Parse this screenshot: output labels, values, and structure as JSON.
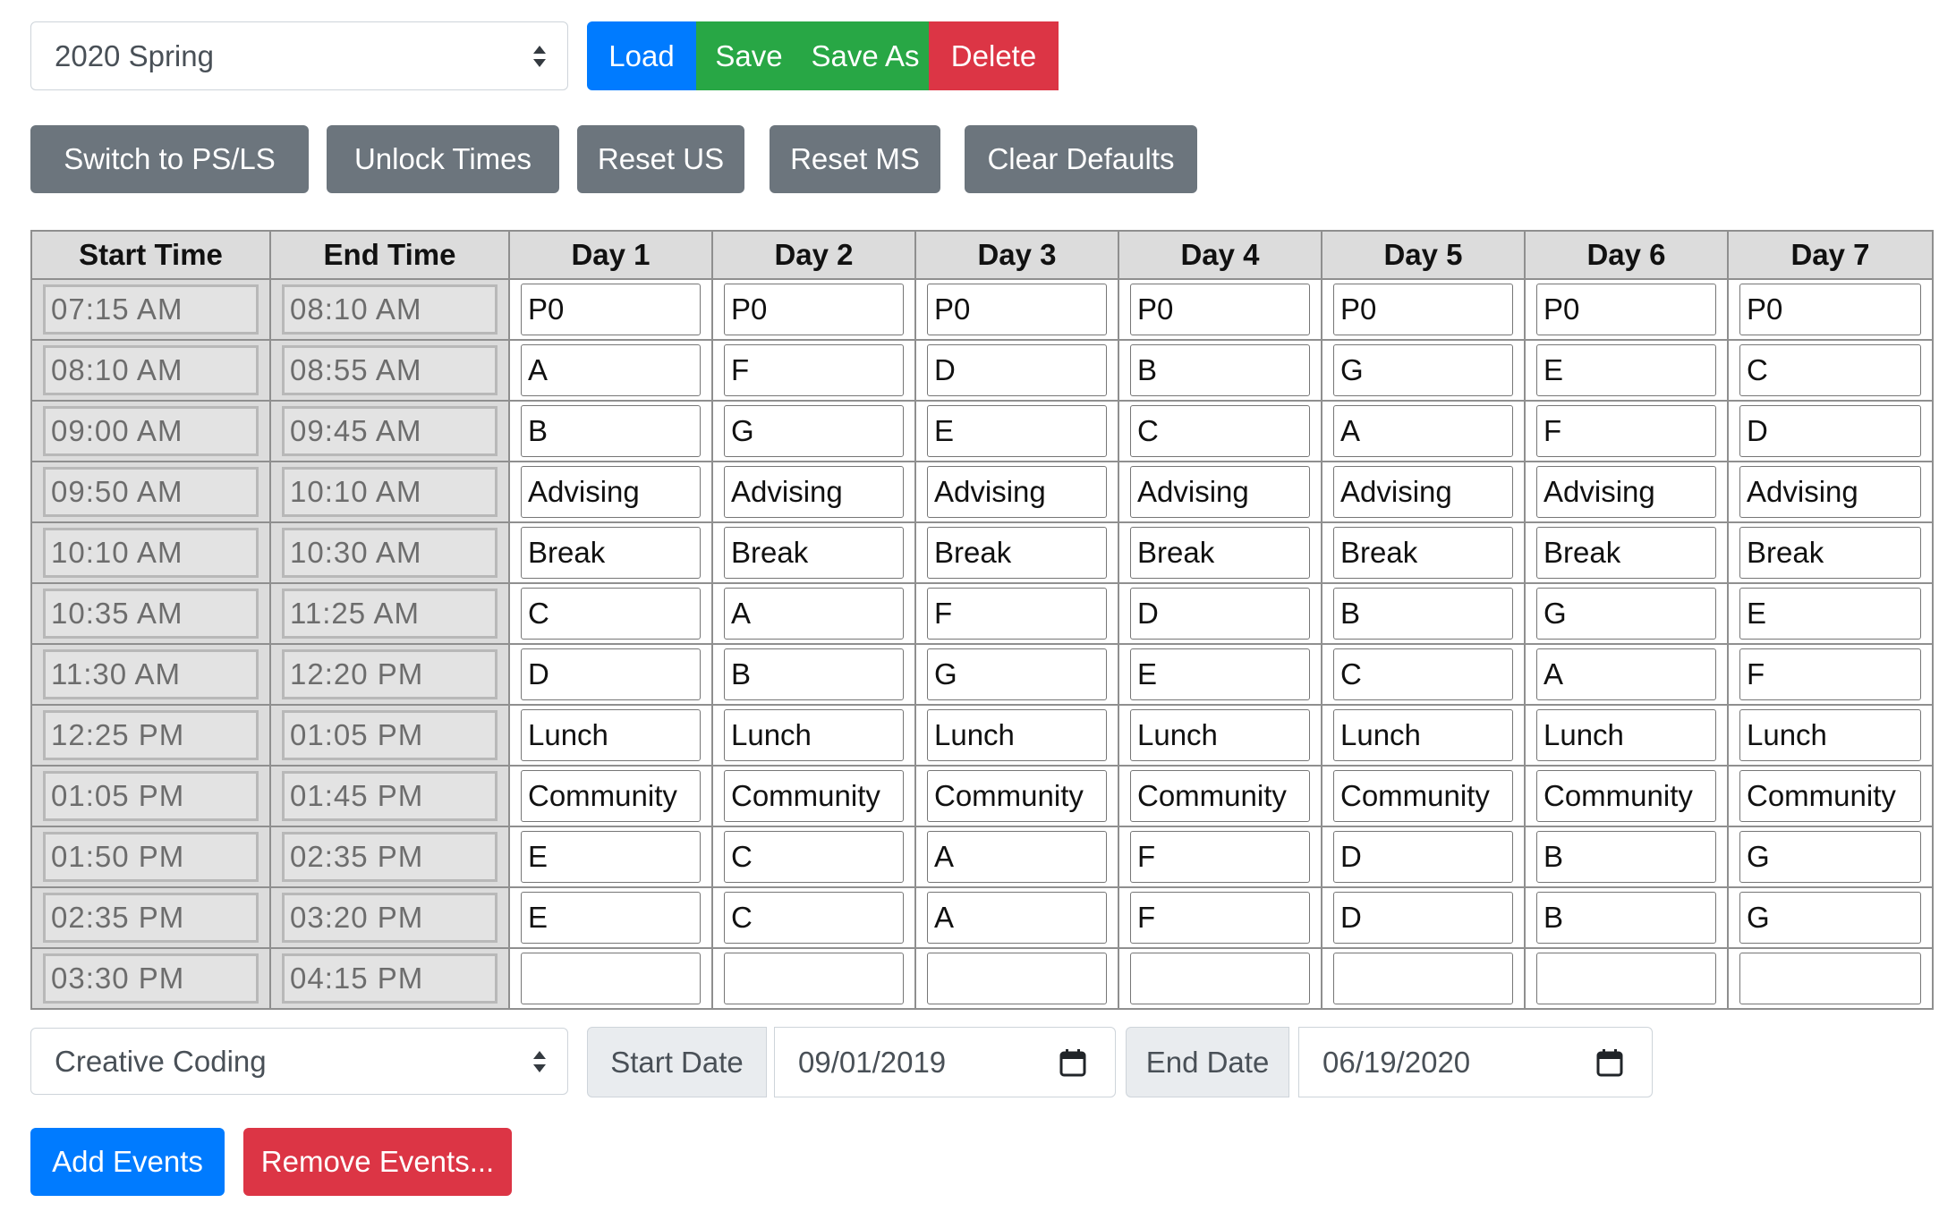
{
  "semester_select": {
    "value": "2020 Spring"
  },
  "file_buttons": {
    "load": "Load",
    "save": "Save",
    "save_as": "Save As",
    "delete": "Delete"
  },
  "tool_buttons": {
    "switch": "Switch to PS/LS",
    "unlock": "Unlock Times",
    "reset_us": "Reset US",
    "reset_ms": "Reset MS",
    "clear": "Clear Defaults"
  },
  "table": {
    "headers": [
      "Start Time",
      "End Time",
      "Day 1",
      "Day 2",
      "Day 3",
      "Day 4",
      "Day 5",
      "Day 6",
      "Day 7"
    ],
    "rows": [
      {
        "start": "07:15 AM",
        "end": "08:10 AM",
        "days": [
          "P0",
          "P0",
          "P0",
          "P0",
          "P0",
          "P0",
          "P0"
        ]
      },
      {
        "start": "08:10 AM",
        "end": "08:55 AM",
        "days": [
          "A",
          "F",
          "D",
          "B",
          "G",
          "E",
          "C"
        ]
      },
      {
        "start": "09:00 AM",
        "end": "09:45 AM",
        "days": [
          "B",
          "G",
          "E",
          "C",
          "A",
          "F",
          "D"
        ]
      },
      {
        "start": "09:50 AM",
        "end": "10:10 AM",
        "days": [
          "Advising",
          "Advising",
          "Advising",
          "Advising",
          "Advising",
          "Advising",
          "Advising"
        ]
      },
      {
        "start": "10:10 AM",
        "end": "10:30 AM",
        "days": [
          "Break",
          "Break",
          "Break",
          "Break",
          "Break",
          "Break",
          "Break"
        ]
      },
      {
        "start": "10:35 AM",
        "end": "11:25 AM",
        "days": [
          "C",
          "A",
          "F",
          "D",
          "B",
          "G",
          "E"
        ]
      },
      {
        "start": "11:30 AM",
        "end": "12:20 PM",
        "days": [
          "D",
          "B",
          "G",
          "E",
          "C",
          "A",
          "F"
        ]
      },
      {
        "start": "12:25 PM",
        "end": "01:05 PM",
        "days": [
          "Lunch",
          "Lunch",
          "Lunch",
          "Lunch",
          "Lunch",
          "Lunch",
          "Lunch"
        ]
      },
      {
        "start": "01:05 PM",
        "end": "01:45 PM",
        "days": [
          "Community",
          "Community",
          "Community",
          "Community",
          "Community",
          "Community",
          "Community"
        ]
      },
      {
        "start": "01:50 PM",
        "end": "02:35 PM",
        "days": [
          "E",
          "C",
          "A",
          "F",
          "D",
          "B",
          "G"
        ]
      },
      {
        "start": "02:35 PM",
        "end": "03:20 PM",
        "days": [
          "E",
          "C",
          "A",
          "F",
          "D",
          "B",
          "G"
        ]
      },
      {
        "start": "03:30 PM",
        "end": "04:15 PM",
        "days": [
          "",
          "",
          "",
          "",
          "",
          "",
          ""
        ]
      }
    ]
  },
  "course_select": {
    "value": "Creative Coding"
  },
  "start_date": {
    "label": "Start Date",
    "value": "09/01/2019"
  },
  "end_date": {
    "label": "End Date",
    "value": "06/19/2020"
  },
  "event_buttons": {
    "add": "Add Events",
    "remove": "Remove Events..."
  },
  "icons": {
    "select_caret": "up-down-caret-icon",
    "calendar": "calendar-icon"
  },
  "colors": {
    "primary": "#007bff",
    "success": "#28a745",
    "danger": "#dc3545",
    "secondary": "#6c757d"
  }
}
